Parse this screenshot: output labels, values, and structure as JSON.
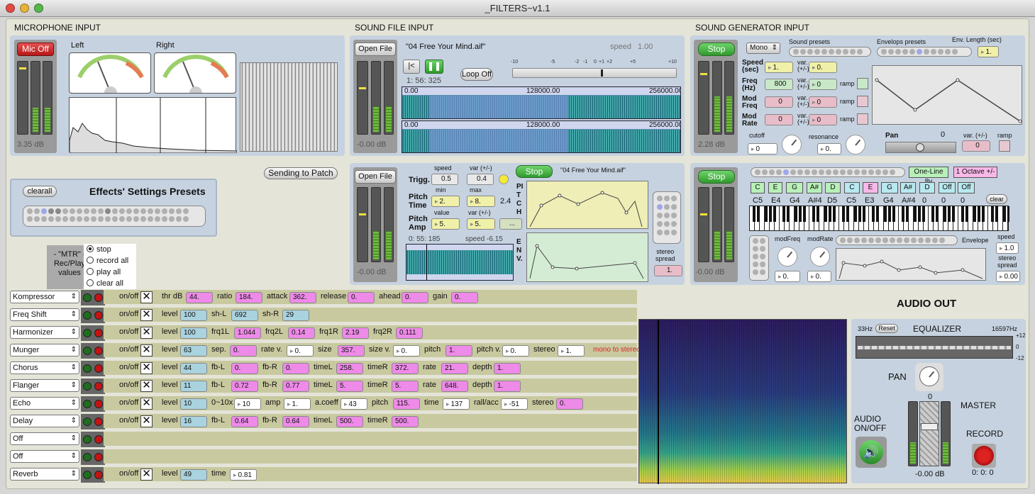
{
  "window": {
    "title": "_FILTERS~v1.1"
  },
  "mic": {
    "title": "MICROPHONE INPUT",
    "button": "Mic Off",
    "left": "Left",
    "right": "Right",
    "db": "3.35  dB"
  },
  "file": {
    "title": "SOUND FILE INPUT",
    "open": "Open File",
    "filename": "\"04 Free Your Mind.aif\"",
    "speed_label": "speed",
    "speed": "1.00",
    "ruler": [
      "-10",
      "-5",
      "-2",
      "-1",
      "0",
      "+1",
      "+2",
      "+5",
      "+10"
    ],
    "time": "1: 56: 325",
    "loop": "Loop Off",
    "db": "-0.00  dB",
    "w1": "0.00",
    "w2": "128000.00",
    "w3": "256000.00",
    "w4": "0.00",
    "w5": "128000.00",
    "w6": "256000.00"
  },
  "gen": {
    "title": "SOUND GENERATOR INPUT",
    "stop": "Stop",
    "mono": "Mono",
    "sound_presets": "Sound presets",
    "env_presets": "Envelops presets",
    "env_length": "Env. Length (sec)",
    "env_val": "1.",
    "speed_l": "Speed",
    "speed_s": "(sec)",
    "speed": "1.",
    "speed_var": "0.",
    "freq_l": "Freq",
    "freq_s": "(Hz)",
    "freq": "800",
    "freq_var": "0",
    "modfreq_l": "Mod",
    "modfreq_s": "Freq",
    "modfreq": "0",
    "modfreq_var": "0",
    "modrate_l": "Mod",
    "modrate_s": "Rate",
    "modrate": "0",
    "modrate_var": "0",
    "var": "var.",
    "pm": "(+/-)",
    "ramp": "ramp",
    "cutoff": "cutoff",
    "cutoff_val": "0",
    "resonance": "resonance",
    "res_val": "0.",
    "pan": "Pan",
    "pan_val": "0",
    "pvar": "var. (+/-)",
    "pvar_val": "0",
    "pramp": "ramp",
    "db": "2.28  dB"
  },
  "presets": {
    "clear": "clearall",
    "title": "Effects' Settings Presets",
    "sending": "Sending to Patch"
  },
  "mtr": {
    "l1": "- \"MTR\" -",
    "l2": "Rec/Play",
    "l3": "values",
    "opts": [
      "stop",
      "record all",
      "play all",
      "clear all"
    ]
  },
  "sampler": {
    "open": "Open File",
    "db": "-0.00  dB",
    "trigg": "Trigg.",
    "speed_h": "speed",
    "var_h": "var (+/-)",
    "trig_speed": "0.5",
    "trig_var": "0.4",
    "stop": "Stop",
    "fname": "\"04 Free Your Mind.aif\"",
    "min": "min",
    "max": "max",
    "pt1": "Pitch",
    "pt2": "Time",
    "pt_min": "2.",
    "pt_max": "8.",
    "pt_ex": "2.4",
    "value": "value",
    "var2": "var (+/-)",
    "pa1": "Pitch",
    "pa2": "Amp",
    "pa_val": "5.",
    "pa_var": "5.",
    "dots": "...",
    "pitch_v": "PITCH",
    "env_v": "ENV.",
    "wave_time": "0: 55: 185",
    "wave_speed": "speed  -6.15",
    "stereo_l1": "stereo",
    "stereo_l2": "spread",
    "stereo": "1."
  },
  "synth": {
    "stop": "Stop",
    "oneline": "One-Line 8v",
    "octave": "1 Octave +/-",
    "notes": [
      "C",
      "E",
      "G",
      "A#",
      "D",
      "C",
      "E",
      "G",
      "A#",
      "D",
      "Off",
      "Off"
    ],
    "oct": [
      "C5",
      "E4",
      "G4",
      "A#4",
      "D5",
      "C5",
      "E3",
      "G4",
      "A#4",
      "0",
      "0",
      "0"
    ],
    "clear": "clear",
    "modfreq": "modFreq",
    "modrate": "modRate",
    "envelope": "Envelope",
    "mf_val": "0.",
    "mr_val": "0.",
    "speed": "speed",
    "speed_val": "1.0",
    "ss1": "stereo",
    "ss2": "spread",
    "ss_val": "0.00",
    "db": "-0.00  dB"
  },
  "fx": [
    {
      "name": "Kompressor",
      "params": [
        [
          "on/off",
          ""
        ],
        [
          "thr dB",
          "44."
        ],
        [
          "ratio",
          "184."
        ],
        [
          "attack",
          "362."
        ],
        [
          "release",
          "0."
        ],
        [
          "ahead",
          "0."
        ],
        [
          "gain",
          "0."
        ]
      ]
    },
    {
      "name": "Freq Shift",
      "params": [
        [
          "on/off",
          ""
        ],
        [
          "level",
          "100"
        ],
        [
          "sh-L",
          "692"
        ],
        [
          "sh-R",
          "29"
        ]
      ]
    },
    {
      "name": "Harmonizer",
      "params": [
        [
          "on/off",
          ""
        ],
        [
          "level",
          "100"
        ],
        [
          "frq1L",
          "1.044"
        ],
        [
          "frq2L",
          "0.14"
        ],
        [
          "frq1R",
          "2.19"
        ],
        [
          "frq2R",
          "0.111"
        ]
      ]
    },
    {
      "name": "Munger",
      "params": [
        [
          "on/off",
          ""
        ],
        [
          "level",
          "63"
        ],
        [
          "sep.",
          "0."
        ],
        [
          "rate v.",
          "0."
        ],
        [
          "size",
          "357."
        ],
        [
          "size v.",
          "0."
        ],
        [
          "pitch",
          "1."
        ],
        [
          "pitch v.",
          "0."
        ],
        [
          "stereo",
          "1."
        ]
      ],
      "extra": "mono to stereo"
    },
    {
      "name": "Chorus",
      "params": [
        [
          "on/off",
          ""
        ],
        [
          "level",
          "44"
        ],
        [
          "fb-L",
          "0."
        ],
        [
          "fb-R",
          "0."
        ],
        [
          "timeL",
          "258."
        ],
        [
          "timeR",
          "372."
        ],
        [
          "rate",
          "21."
        ],
        [
          "depth",
          "1."
        ]
      ]
    },
    {
      "name": "Flanger",
      "params": [
        [
          "on/off",
          ""
        ],
        [
          "level",
          "11"
        ],
        [
          "fb-L",
          "0.72"
        ],
        [
          "fb-R",
          "0.77"
        ],
        [
          "timeL",
          "5."
        ],
        [
          "timeR",
          "5."
        ],
        [
          "rate",
          "648."
        ],
        [
          "depth",
          "1."
        ]
      ]
    },
    {
      "name": "Echo",
      "params": [
        [
          "on/off",
          ""
        ],
        [
          "level",
          "10"
        ],
        [
          "0~10x",
          "10"
        ],
        [
          "amp",
          "1."
        ],
        [
          "a.coeff",
          "43"
        ],
        [
          "pitch",
          "115."
        ],
        [
          "time",
          "137"
        ],
        [
          "rall/acc",
          "-51"
        ],
        [
          "stereo",
          "0."
        ]
      ]
    },
    {
      "name": "Delay",
      "params": [
        [
          "on/off",
          ""
        ],
        [
          "level",
          "16"
        ],
        [
          "fb-L",
          "0.64"
        ],
        [
          "fb-R",
          "0.64"
        ],
        [
          "timeL",
          "500."
        ],
        [
          "timeR",
          "500."
        ]
      ]
    },
    {
      "name": "Off",
      "params": []
    },
    {
      "name": "Off",
      "params": []
    },
    {
      "name": "Reverb",
      "params": [
        [
          "on/off",
          ""
        ],
        [
          "level",
          "49"
        ],
        [
          "time",
          "0.81"
        ]
      ]
    }
  ],
  "out": {
    "title": "AUDIO OUT",
    "lo": "33Hz",
    "reset": "Reset",
    "eq": "EQUALIZER",
    "hi": "16597Hz",
    "p12": "+12",
    "z": "0",
    "m12": "-12",
    "pan": "PAN",
    "zero": "0",
    "master": "MASTER",
    "onoff1": "AUDIO",
    "onoff2": "ON/OFF",
    "record": "RECORD",
    "rectime": "0: 0: 0",
    "db": "-0.00 dB"
  }
}
